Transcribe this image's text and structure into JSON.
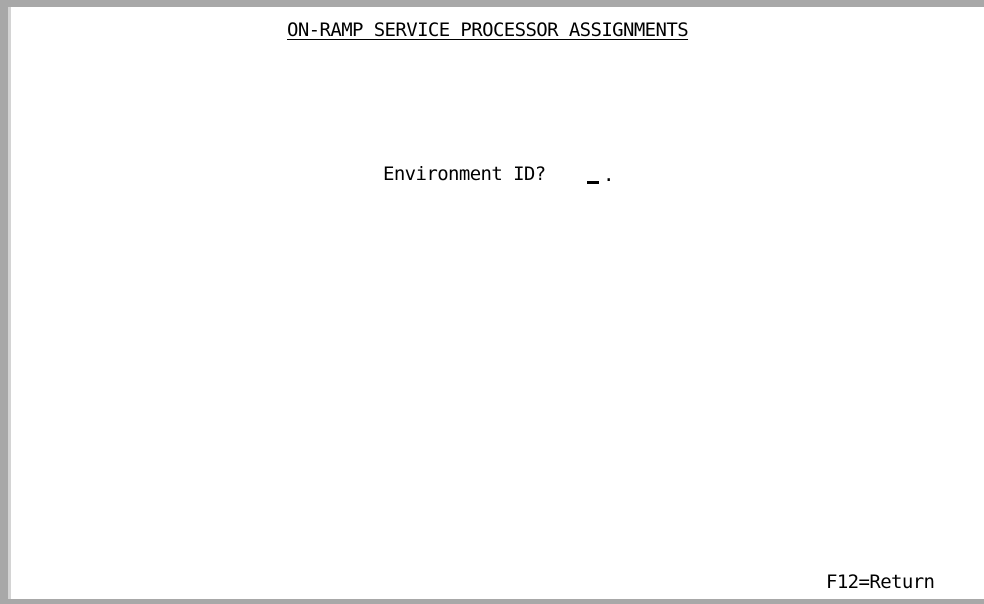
{
  "screen": {
    "title": "ON-RAMP SERVICE PROCESSOR ASSIGNMENTS",
    "prompt": {
      "label": "Environment ID?",
      "value": "",
      "field_terminator": "."
    },
    "function_keys": [
      {
        "label": "F12=Return"
      }
    ]
  }
}
